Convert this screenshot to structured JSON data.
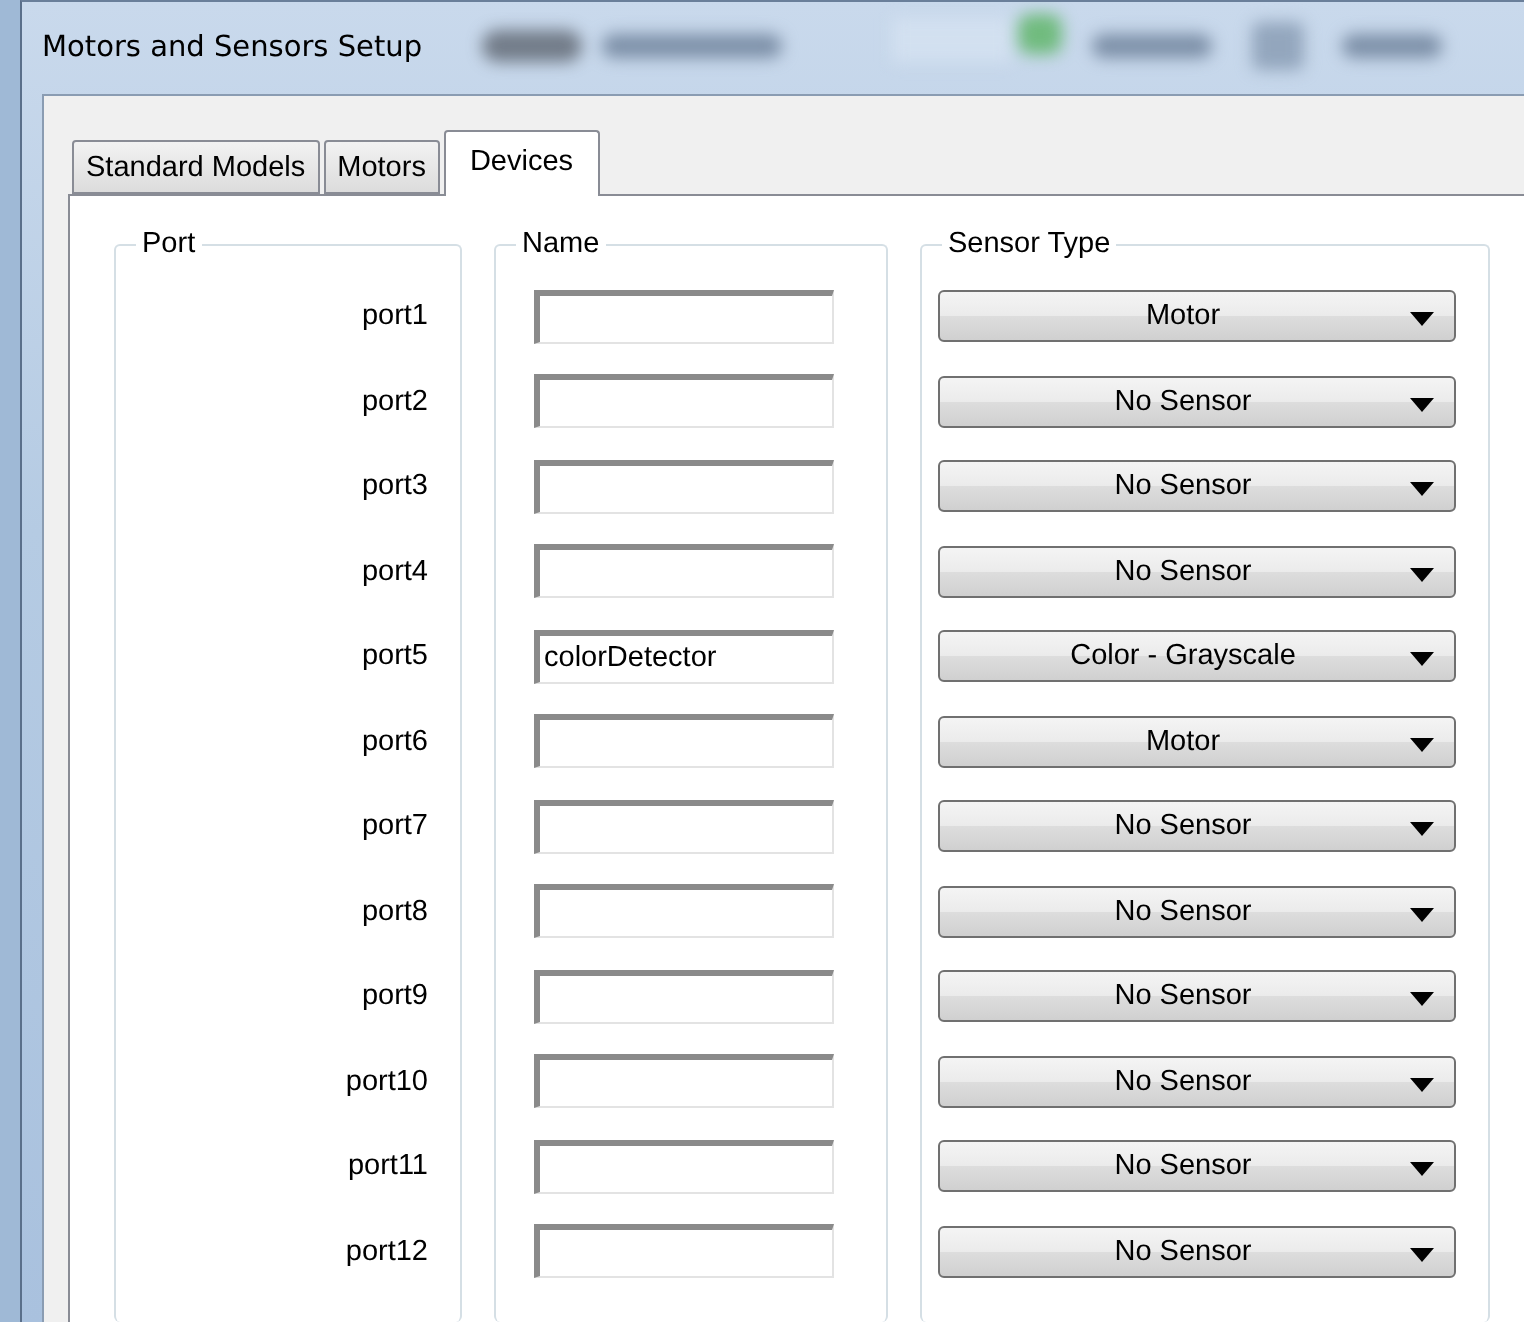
{
  "window": {
    "title": "Motors and Sensors Setup"
  },
  "tabs": [
    {
      "label": "Standard Models",
      "selected": false
    },
    {
      "label": "Motors",
      "selected": false
    },
    {
      "label": "Devices",
      "selected": true
    }
  ],
  "groups": {
    "port": "Port",
    "name": "Name",
    "sensor_type": "Sensor Type"
  },
  "rows": [
    {
      "port": "port1",
      "name": "",
      "sensor": "Motor"
    },
    {
      "port": "port2",
      "name": "",
      "sensor": "No Sensor"
    },
    {
      "port": "port3",
      "name": "",
      "sensor": "No Sensor"
    },
    {
      "port": "port4",
      "name": "",
      "sensor": "No Sensor"
    },
    {
      "port": "port5",
      "name": "colorDetector",
      "sensor": "Color - Grayscale"
    },
    {
      "port": "port6",
      "name": "",
      "sensor": "Motor"
    },
    {
      "port": "port7",
      "name": "",
      "sensor": "No Sensor"
    },
    {
      "port": "port8",
      "name": "",
      "sensor": "No Sensor"
    },
    {
      "port": "port9",
      "name": "",
      "sensor": "No Sensor"
    },
    {
      "port": "port10",
      "name": "",
      "sensor": "No Sensor"
    },
    {
      "port": "port11",
      "name": "",
      "sensor": "No Sensor"
    },
    {
      "port": "port12",
      "name": "",
      "sensor": "No Sensor"
    }
  ]
}
